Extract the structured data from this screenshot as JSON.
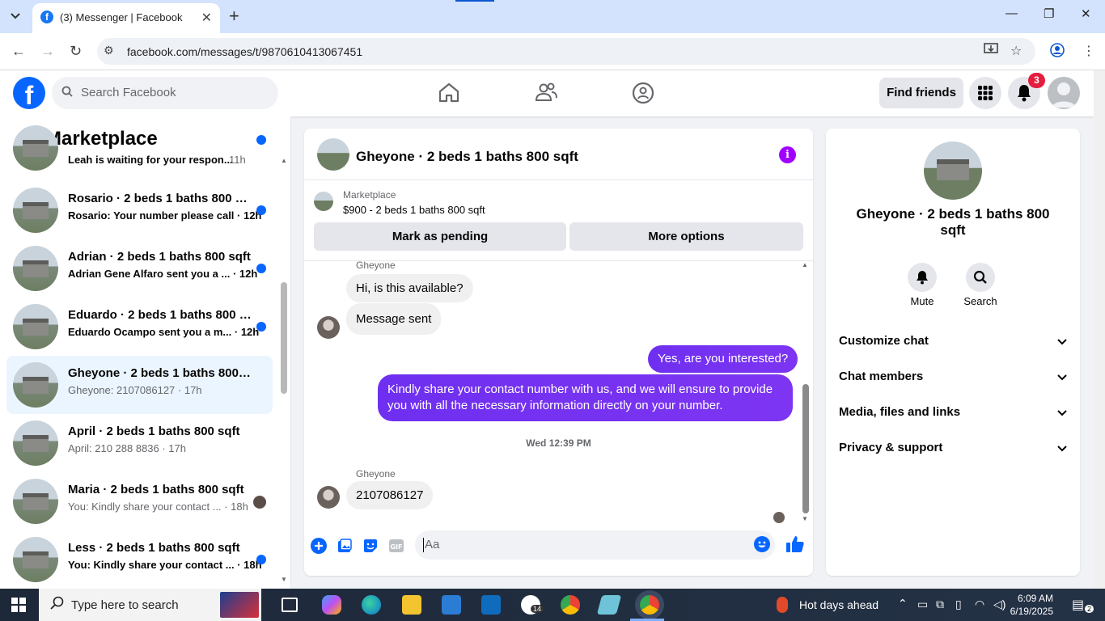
{
  "browser": {
    "tab_title": "(3) Messenger | Facebook",
    "url": "facebook.com/messages/t/9870610413067451"
  },
  "fb": {
    "search_placeholder": "Search Facebook",
    "find_friends": "Find friends",
    "notif_count": "3"
  },
  "left": {
    "title": "Marketplace",
    "conversations": [
      {
        "name": "Leah is waiting for your respon...",
        "preview": "",
        "time": "11h",
        "unread": true,
        "indicator": "dot"
      },
      {
        "name": "Rosario · 2 beds 1 baths 800 sqft",
        "preview": "Rosario: Your number please call · 12h",
        "unread": true,
        "indicator": "dot"
      },
      {
        "name": "Adrian · 2 beds 1 baths 800 sqft",
        "preview": "Adrian Gene Alfaro sent you a ... · 12h",
        "unread": true,
        "indicator": "dot"
      },
      {
        "name": "Eduardo · 2 beds 1 baths 800 s...",
        "preview": "Eduardo Ocampo sent you a m... · 12h",
        "unread": true,
        "indicator": "dot"
      },
      {
        "name": "Gheyone · 2 beds 1 baths 800 sqft",
        "preview": "Gheyone: 2107086127 · 17h",
        "unread": false,
        "indicator": "none"
      },
      {
        "name": "April · 2 beds 1 baths 800 sqft",
        "preview": "April: 210 288 8836 · 17h",
        "unread": false,
        "indicator": "none"
      },
      {
        "name": "Maria · 2 beds 1 baths 800 sqft",
        "preview": "You: Kindly share your contact ... · 18h",
        "unread": false,
        "indicator": "avatar"
      },
      {
        "name": "Less · 2 beds 1 baths 800 sqft",
        "preview": "You: Kindly share your contact ... · 18h",
        "unread": true,
        "indicator": "dot"
      }
    ]
  },
  "chat": {
    "title": "Gheyone · 2 beds 1 baths 800 sqft",
    "marketplace_label": "Marketplace",
    "listing": "$900 - 2 beds 1 baths 800 sqft",
    "mark_pending": "Mark as pending",
    "more_options": "More options",
    "sender_name": "Gheyone",
    "msg_in_1": "Hi, is this available?",
    "msg_in_2": "Message sent",
    "msg_out_1": "Yes, are you interested?",
    "msg_out_2": "Kindly share your contact number with us, and we will ensure to provide you with all the necessary information directly on your number.",
    "timestamp": "Wed 12:39 PM",
    "sender_name_2": "Gheyone",
    "msg_in_3": "2107086127",
    "composer_placeholder": "Aa"
  },
  "right": {
    "name": "Gheyone · 2 beds 1 baths 800 sqft",
    "mute": "Mute",
    "search": "Search",
    "rows": [
      "Customize chat",
      "Chat members",
      "Media, files and links",
      "Privacy & support"
    ]
  },
  "taskbar": {
    "search_placeholder": "Type here to search",
    "weather": "Hot days ahead",
    "time": "6:09 AM",
    "date": "6/19/2025",
    "notif": "2",
    "whatsapp_badge": "14"
  },
  "colors": {
    "fb_blue": "#0866ff",
    "messenger_purple": "#7b2ef0",
    "unread_dot": "#0866ff",
    "badge_red": "#e41e3f"
  }
}
